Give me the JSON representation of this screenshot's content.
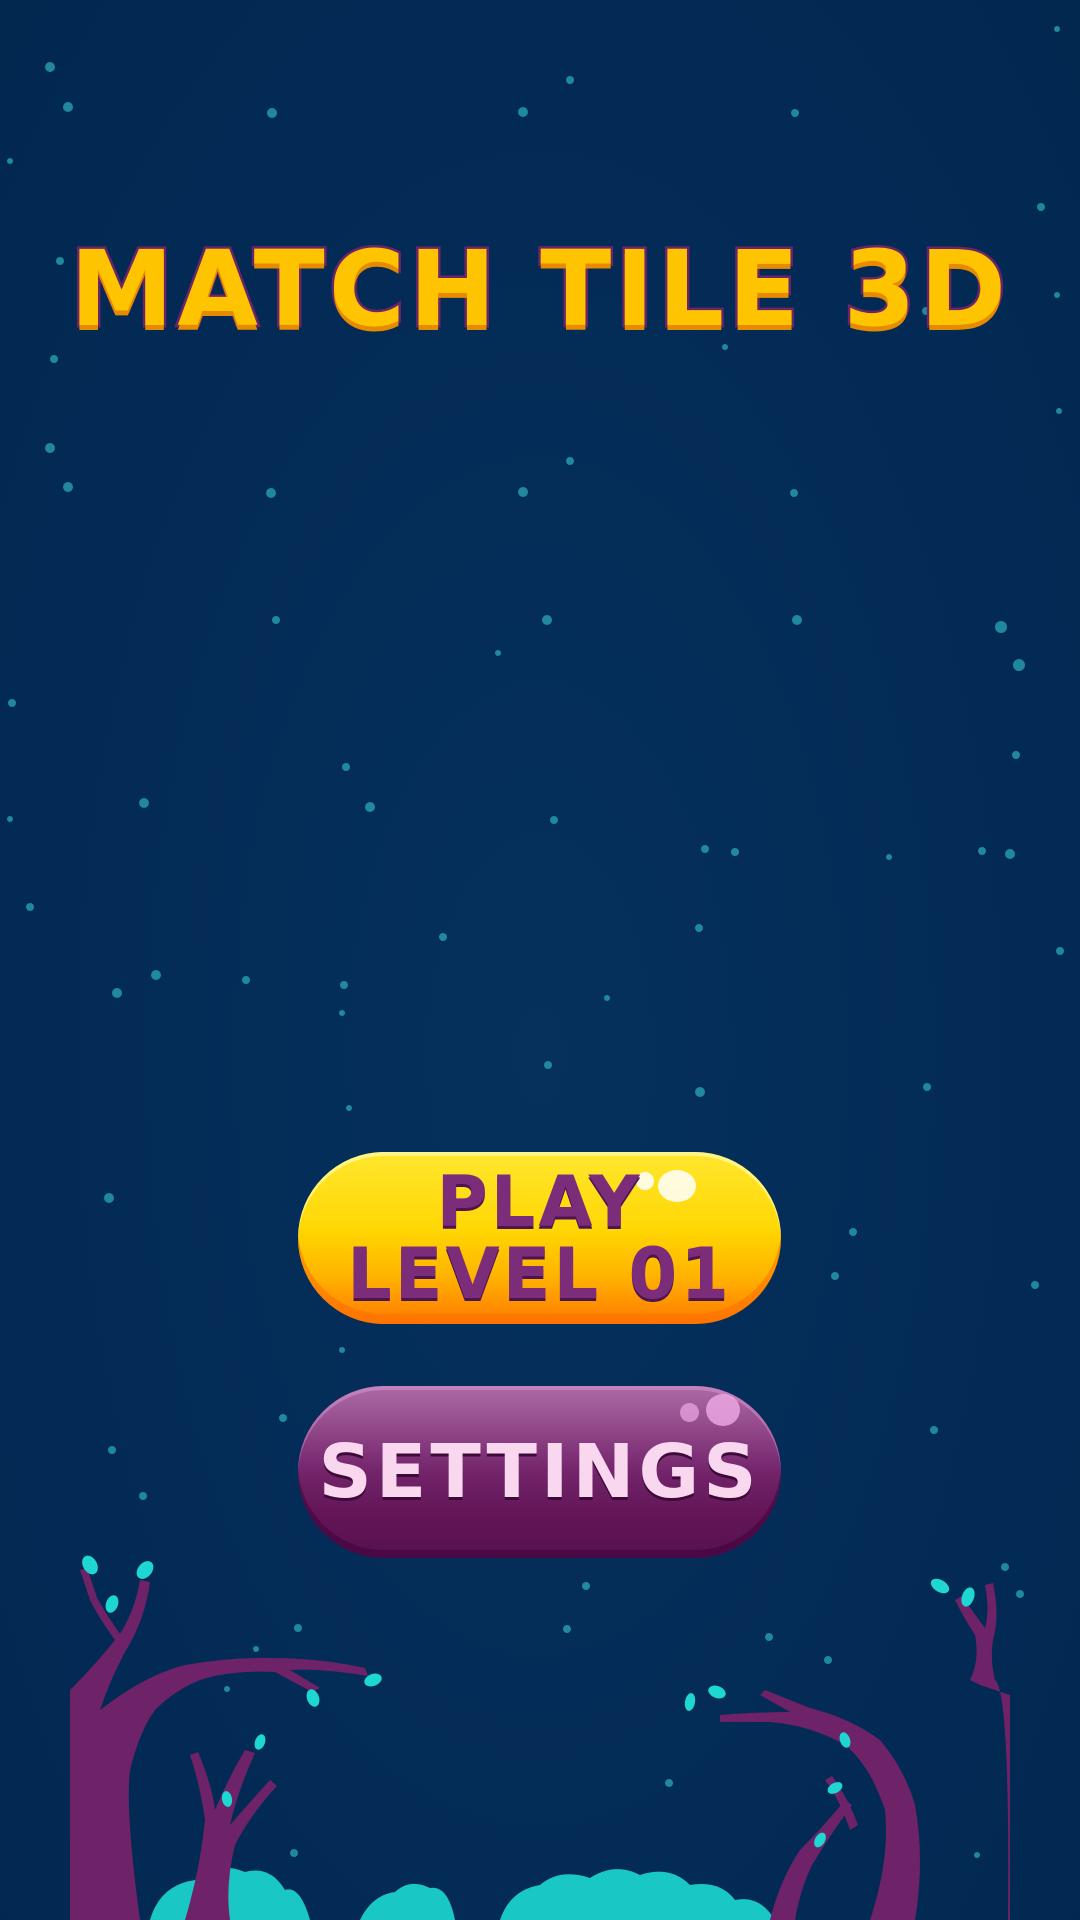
{
  "game": {
    "title": "MATCH TILE 3D"
  },
  "menu": {
    "play_line1": "PLAY",
    "play_line2": "LEVEL 01",
    "settings_label": "SETTINGS"
  },
  "colors": {
    "background": "#032b56",
    "title_fill": "#ffc400",
    "play_button": "#ffd600",
    "settings_button": "#7a2a72",
    "tree": "#6e2268",
    "leaf": "#18d3d0",
    "bush": "#19c8c4"
  }
}
